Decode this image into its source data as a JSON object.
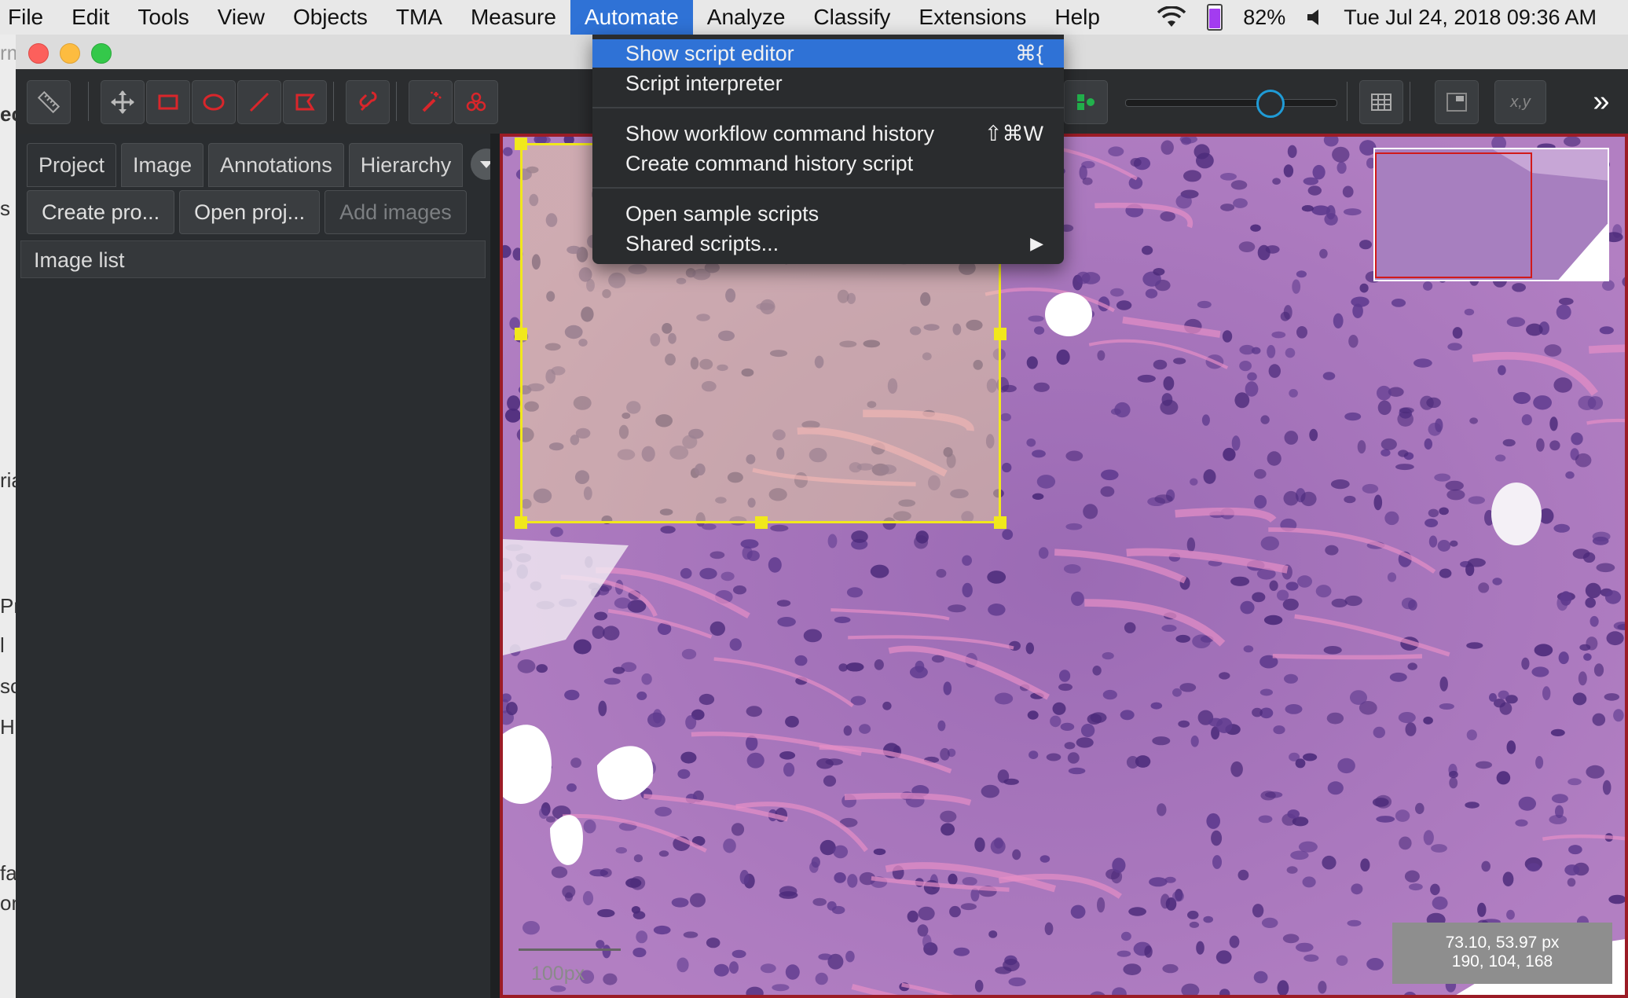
{
  "menubar": {
    "items": [
      {
        "label": "File",
        "active": false
      },
      {
        "label": "Edit",
        "active": false
      },
      {
        "label": "Tools",
        "active": false
      },
      {
        "label": "View",
        "active": false
      },
      {
        "label": "Objects",
        "active": false
      },
      {
        "label": "TMA",
        "active": false
      },
      {
        "label": "Measure",
        "active": false
      },
      {
        "label": "Automate",
        "active": true
      },
      {
        "label": "Analyze",
        "active": false
      },
      {
        "label": "Classify",
        "active": false
      },
      {
        "label": "Extensions",
        "active": false
      },
      {
        "label": "Help",
        "active": false
      }
    ],
    "status": {
      "wifi_icon": "wifi-icon",
      "battery_icon": "battery-icon",
      "battery_percent": "82%",
      "volume_icon": "speaker-icon",
      "datetime": "Tue Jul 24, 2018 09:36 AM"
    }
  },
  "colors": {
    "accent": "#2f72d6",
    "toolbar_icon": "#d9262b",
    "roi": "#f1e81c",
    "viewer_border": "#9b1c26"
  },
  "toolbar": {
    "icons": [
      "ruler-icon",
      "move-icon",
      "rectangle-icon",
      "ellipse-icon",
      "line-icon",
      "polygon-icon",
      "brush-icon",
      "wand-icon",
      "points-icon",
      "classify-icon",
      "opacity-slider",
      "grid-icon",
      "overview-icon",
      "coordinates-icon",
      "more-icon"
    ],
    "coords_label": "x,y",
    "more_label": "»",
    "opacity": 0.68
  },
  "left_pane": {
    "tabs": [
      {
        "label": "Project"
      },
      {
        "label": "Image"
      },
      {
        "label": "Annotations"
      },
      {
        "label": "Hierarchy"
      }
    ],
    "buttons": [
      {
        "label": "Create pro...",
        "enabled": true
      },
      {
        "label": "Open proj...",
        "enabled": true
      },
      {
        "label": "Add images",
        "enabled": false
      }
    ],
    "image_list_label": "Image list"
  },
  "dropdown": {
    "items": [
      {
        "label": "Show script editor",
        "shortcut": "⌘{",
        "highlighted": true
      },
      {
        "label": "Script interpreter",
        "shortcut": ""
      },
      {
        "label": "Show workflow command history",
        "shortcut": "⇧⌘W"
      },
      {
        "label": "Create command history script",
        "shortcut": ""
      },
      {
        "label": "Open sample scripts",
        "shortcut": ""
      },
      {
        "label": "Shared scripts...",
        "shortcut": "▶"
      }
    ]
  },
  "viewer": {
    "scale_label": "100px",
    "cursor_position": "73.10, 53.97 px",
    "pixel_rgb": "190, 104, 168"
  },
  "background_window": {
    "text_fragments": [
      "rm",
      "ec",
      "s",
      "ria",
      "Pro",
      "l",
      "sc",
      "H",
      "fau",
      "on"
    ]
  }
}
